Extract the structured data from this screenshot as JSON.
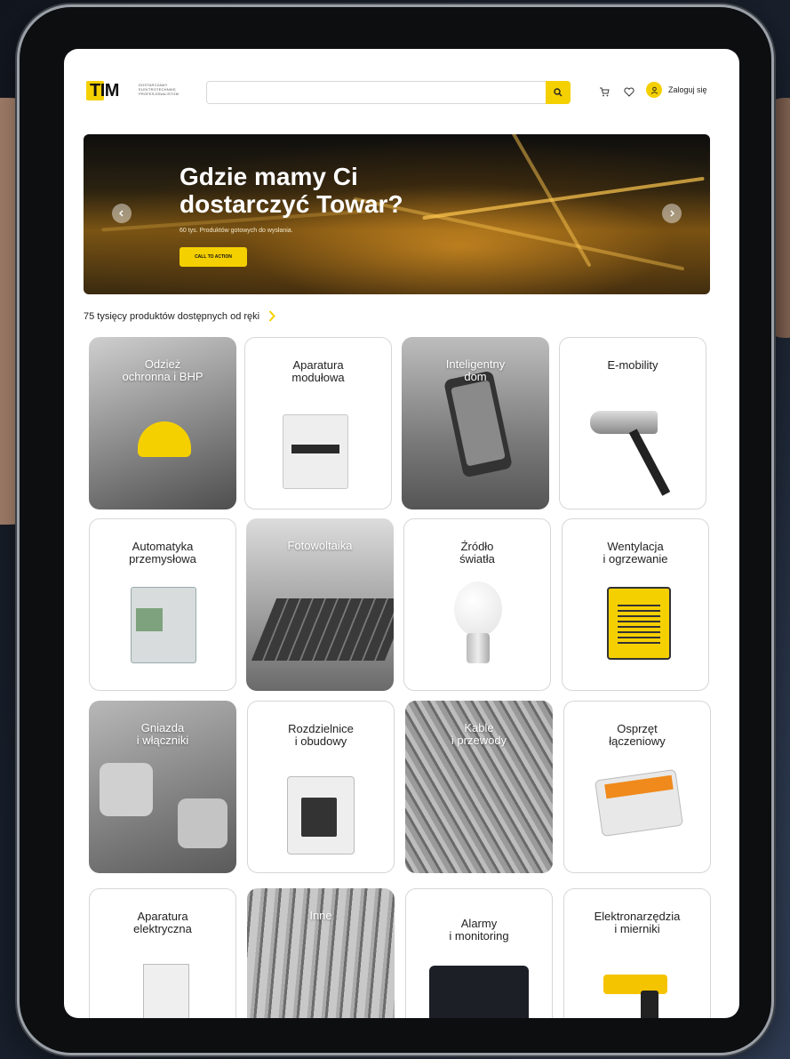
{
  "header": {
    "logo_text": "TIM",
    "tagline": "DOSTARCZAMY ELEKTROTECHNIKĘ PROFESJONALISTOM",
    "search": {
      "value": "",
      "placeholder": ""
    },
    "login_label": "Zaloguj się"
  },
  "hero": {
    "title": "Gdzie mamy Ci dostarczyć Towar?",
    "subtitle": "60 tys. Produktów gotowych do wysłania.",
    "cta_label": "CALL TO ACTION"
  },
  "strip": {
    "text": "75 tysięcy produktów dostępnych od ręki"
  },
  "categories": [
    {
      "label": "Odzież\nochronna i BHP"
    },
    {
      "label": "Aparatura\nmodułowa"
    },
    {
      "label": "Inteligentny\ndom"
    },
    {
      "label": "E-mobility"
    },
    {
      "label": "Automatyka\nprzemysłowa"
    },
    {
      "label": "Fotowoltaika"
    },
    {
      "label": "Źródło\nświatła"
    },
    {
      "label": "Wentylacja\ni ogrzewanie"
    },
    {
      "label": "Gniazda\ni włączniki"
    },
    {
      "label": "Rozdzielnice\ni obudowy"
    },
    {
      "label": "Kable\ni przewody"
    },
    {
      "label": "Osprzęt\nłączeniowy"
    },
    {
      "label": "Aparatura\nelektryczna"
    },
    {
      "label": "Inne"
    },
    {
      "label": "Alarmy\ni monitoring"
    },
    {
      "label": "Elektronarzędzia\ni mierniki"
    }
  ],
  "colors": {
    "accent": "#f5d000",
    "text": "#222222"
  }
}
